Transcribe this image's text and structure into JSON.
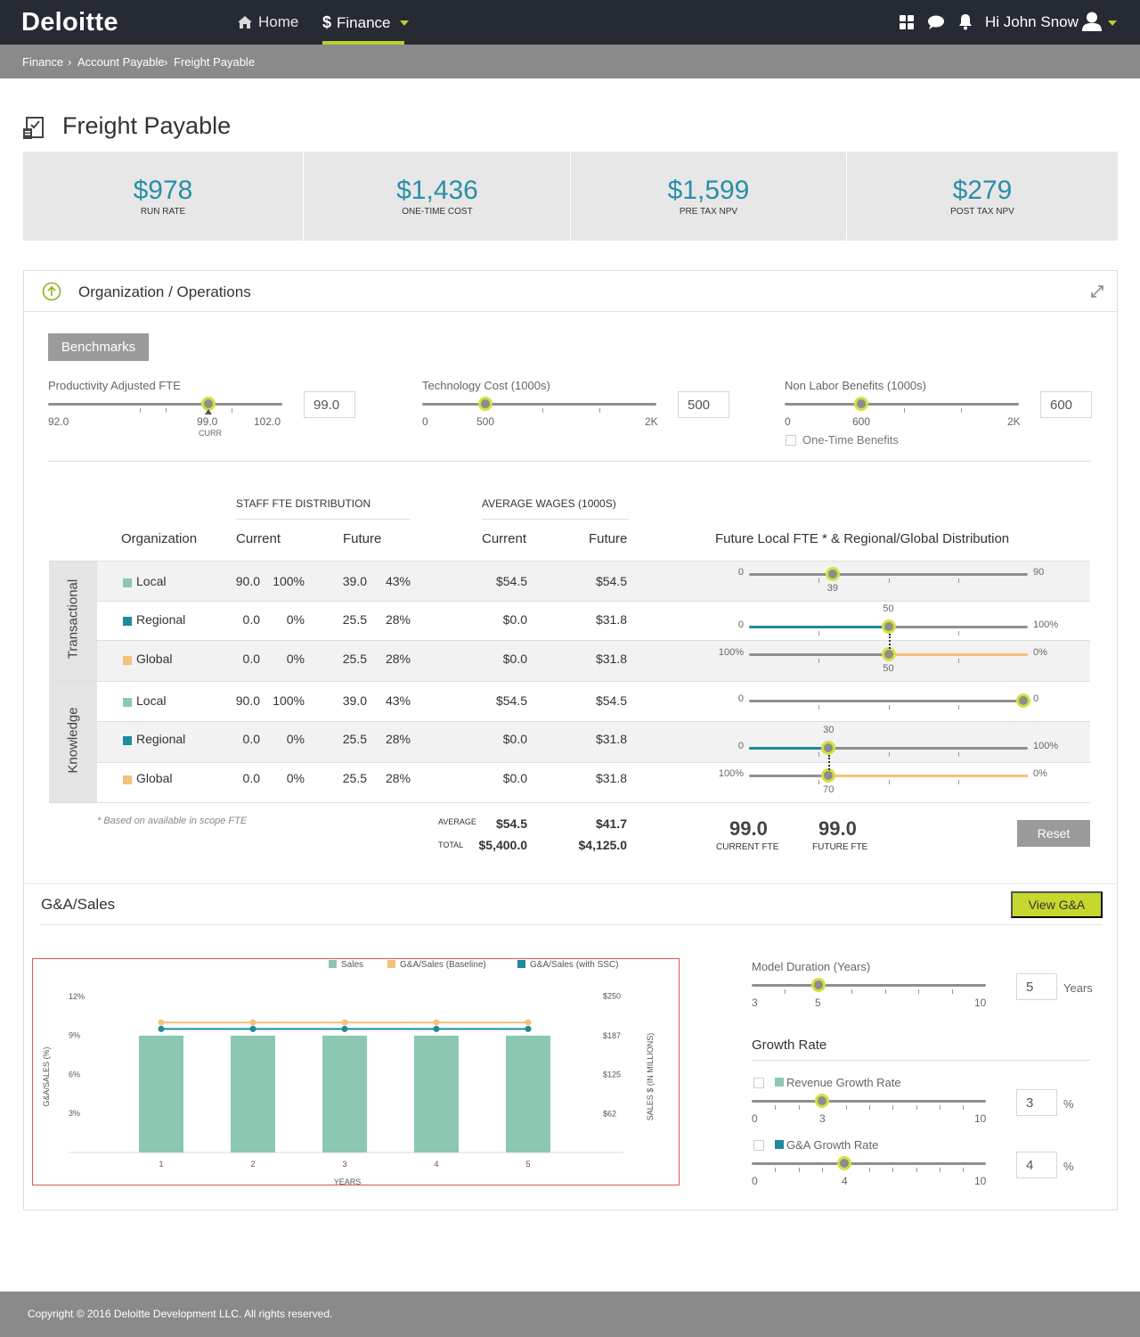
{
  "brand": {
    "logo": "Deloitte",
    "accent": "#b8d12a",
    "teal": "#2a8fa7"
  },
  "nav": {
    "home_label": "Home",
    "finance_label": "Finance",
    "greeting": "Hi John Snow"
  },
  "breadcrumb": [
    "Finance",
    "Account Payable",
    "Freight Payable"
  ],
  "page": {
    "title": "Freight Payable"
  },
  "kpis": [
    {
      "value": "$978",
      "label": "RUN RATE"
    },
    {
      "value": "$1,436",
      "label": "ONE-TIME COST"
    },
    {
      "value": "$1,599",
      "label": "PRE TAX NPV"
    },
    {
      "value": "$279",
      "label": "POST TAX NPV"
    }
  ],
  "org_panel": {
    "title": "Organization / Operations",
    "benchmarks_label": "Benchmarks",
    "sliders": [
      {
        "label": "Productivity Adjusted FTE",
        "min": "92.0",
        "max": "102.0",
        "value_label": "99.0",
        "marker_label": "CURR",
        "input": "99.0",
        "fraction": 0.7
      },
      {
        "label": "Technology Cost (1000s)",
        "min": "0",
        "max": "2K",
        "value_label": "500",
        "input": "500",
        "fraction": 0.27
      },
      {
        "label": "Non Labor Benefits (1000s)",
        "min": "0",
        "max": "2K",
        "value_label": "600",
        "input": "600",
        "fraction": 0.33
      }
    ],
    "one_time_benefits": "One-Time Benefits"
  },
  "table": {
    "group_staff": "STAFF FTE DISTRIBUTION",
    "group_wages": "AVERAGE WAGES (1000S)",
    "col_org": "Organization",
    "col_current": "Current",
    "col_future": "Future",
    "col_wage_current": "Current",
    "col_wage_future": "Future",
    "col_dist": "Future Local FTE * & Regional/Global Distribution",
    "groups": [
      {
        "name": "Transactional",
        "rows": [
          {
            "org": "Local",
            "cur": "90.0",
            "cur_pct": "100%",
            "fut": "39.0",
            "fut_pct": "43%",
            "wc": "$54.5",
            "wf": "$54.5"
          },
          {
            "org": "Regional",
            "cur": "0.0",
            "cur_pct": "0%",
            "fut": "25.5",
            "fut_pct": "28%",
            "wc": "$0.0",
            "wf": "$31.8"
          },
          {
            "org": "Global",
            "cur": "0.0",
            "cur_pct": "0%",
            "fut": "25.5",
            "fut_pct": "28%",
            "wc": "$0.0",
            "wf": "$31.8"
          }
        ],
        "dist": {
          "local": {
            "min": "0",
            "max": "90",
            "value": "39"
          },
          "regional": {
            "min": "0",
            "max": "100%",
            "value": "50"
          },
          "global": {
            "min": "100%",
            "max": "0%",
            "value": "50"
          }
        }
      },
      {
        "name": "Knowledge",
        "rows": [
          {
            "org": "Local",
            "cur": "90.0",
            "cur_pct": "100%",
            "fut": "39.0",
            "fut_pct": "43%",
            "wc": "$54.5",
            "wf": "$54.5"
          },
          {
            "org": "Regional",
            "cur": "0.0",
            "cur_pct": "0%",
            "fut": "25.5",
            "fut_pct": "28%",
            "wc": "$0.0",
            "wf": "$31.8"
          },
          {
            "org": "Global",
            "cur": "0.0",
            "cur_pct": "0%",
            "fut": "25.5",
            "fut_pct": "28%",
            "wc": "$0.0",
            "wf": "$31.8"
          }
        ],
        "dist": {
          "local": {
            "min": "0",
            "max": "0",
            "value": ""
          },
          "regional": {
            "min": "0",
            "max": "100%",
            "value": "30"
          },
          "global": {
            "min": "100%",
            "max": "0%",
            "value": "70"
          }
        }
      }
    ],
    "footnote": "* Based on available in scope FTE",
    "average_label": "AVERAGE",
    "total_label": "TOTAL",
    "avg_current": "$54.5",
    "avg_future": "$41.7",
    "total_current": "$5,400.0",
    "total_future": "$4,125.0",
    "current_fte": "99.0",
    "current_fte_label": "CURRENT FTE",
    "future_fte": "99.0",
    "future_fte_label": "FUTURE FTE",
    "reset_label": "Reset"
  },
  "ga": {
    "title": "G&A/Sales",
    "view_label": "View G&A",
    "model_duration_label": "Model Duration (Years)",
    "model_duration": {
      "min": "3",
      "max": "10",
      "value": "5",
      "input": "5",
      "unit": "Years"
    },
    "growth_rate_title": "Growth Rate",
    "revenue_growth_label": "Revenue Growth Rate",
    "revenue_growth": {
      "min": "0",
      "max": "10",
      "value": "3",
      "input": "3",
      "unit": "%"
    },
    "ga_growth_label": "G&A Growth Rate",
    "ga_growth": {
      "min": "0",
      "max": "10",
      "value": "4",
      "input": "4",
      "unit": "%"
    }
  },
  "chart_data": {
    "type": "bar",
    "categories": [
      "1",
      "2",
      "3",
      "4",
      "5"
    ],
    "series": [
      {
        "name": "Sales",
        "type": "bar",
        "axis": "right",
        "color": "#8cc7b1",
        "values": [
          187,
          187,
          187,
          187,
          187
        ]
      },
      {
        "name": "G&A/Sales (Baseline)",
        "type": "line",
        "axis": "left",
        "color": "#f5c07a",
        "values": [
          10,
          10,
          10,
          10,
          10
        ]
      },
      {
        "name": "G&A/Sales (with SSC)",
        "type": "line",
        "axis": "left",
        "color": "#1f8a9d",
        "values": [
          9.5,
          9.5,
          9.5,
          9.5,
          9.5
        ]
      }
    ],
    "xlabel": "YEARS",
    "ylabel": "G&A/SALES (%)",
    "y2label": "SALES $ (IN MILLIONS)",
    "yticks": [
      "3%",
      "6%",
      "9%",
      "12%"
    ],
    "y2ticks": [
      "$62",
      "$125",
      "$187",
      "$250"
    ],
    "ylim": [
      0,
      13.5
    ],
    "y2lim": [
      0,
      281
    ],
    "legend": "top"
  },
  "footer": {
    "copyright": "Copyright © 2016 Deloitte Development LLC. All rights reserved."
  }
}
